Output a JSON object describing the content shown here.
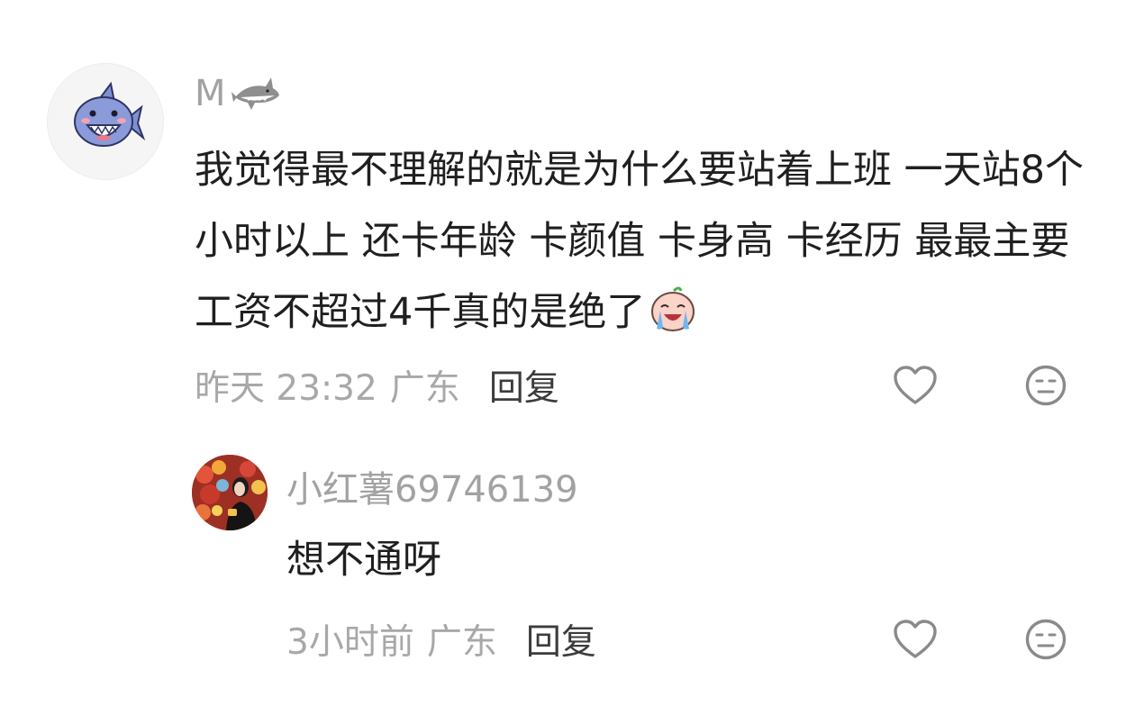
{
  "comment": {
    "username": "M",
    "username_emoji": "shark-icon",
    "text": "我觉得最不理解的就是为什么要站着上班 一天站8个小时以上 还卡年龄 卡颜值 卡身高 卡经历 最最主要工资不超过4千真的是绝了",
    "trailing_emoji": "crying-face-icon",
    "time": "昨天 23:32",
    "location": "广东",
    "reply_label": "回复"
  },
  "reply": {
    "username": "小红薯69746139",
    "text": "想不通呀",
    "time": "3小时前",
    "location": "广东",
    "reply_label": "回复"
  },
  "colors": {
    "meta_gray": "#a8a8a8",
    "text_dark": "#1f1f1f",
    "icon_gray": "#8a8a8a"
  }
}
